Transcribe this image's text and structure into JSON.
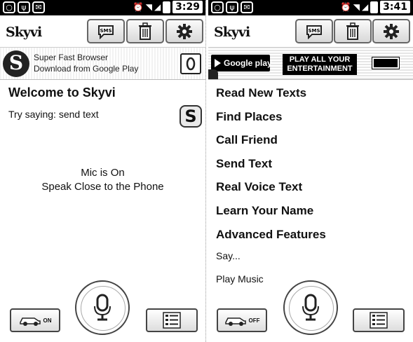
{
  "left": {
    "status_bar": {
      "time": "3:29"
    },
    "app_bar": {
      "logo": "Skyvi",
      "sms_label": "SMS"
    },
    "ad": {
      "line1": "Super Fast Browser",
      "line2": "Download from Google Play"
    },
    "welcome": "Welcome to Skyvi",
    "hint": "Try saying: send text",
    "mic_status_line1": "Mic is On",
    "mic_status_line2": "Speak Close to the Phone",
    "car_mode_label": "ON"
  },
  "right": {
    "status_bar": {
      "time": "3:41"
    },
    "app_bar": {
      "logo": "Skyvi",
      "sms_label": "SMS"
    },
    "ad": {
      "badge": "Google play",
      "headline_line1": "PLAY ALL YOUR",
      "headline_line2": "ENTERTAINMENT"
    },
    "menu": [
      "Read New Texts",
      "Find Places",
      "Call Friend",
      "Send Text",
      "Real Voice Text",
      "Learn Your Name",
      "Advanced Features"
    ],
    "say_label": "Say...",
    "play_music": "Play Music",
    "car_mode_label": "OFF"
  },
  "icons": {
    "status_left": [
      "circle-icon",
      "usb-icon",
      "mail-icon"
    ],
    "status_right": [
      "alarm-icon",
      "wifi-icon",
      "signal-icon",
      "battery-icon"
    ],
    "toolbar": [
      "sms-icon",
      "trash-icon",
      "gear-icon"
    ]
  }
}
